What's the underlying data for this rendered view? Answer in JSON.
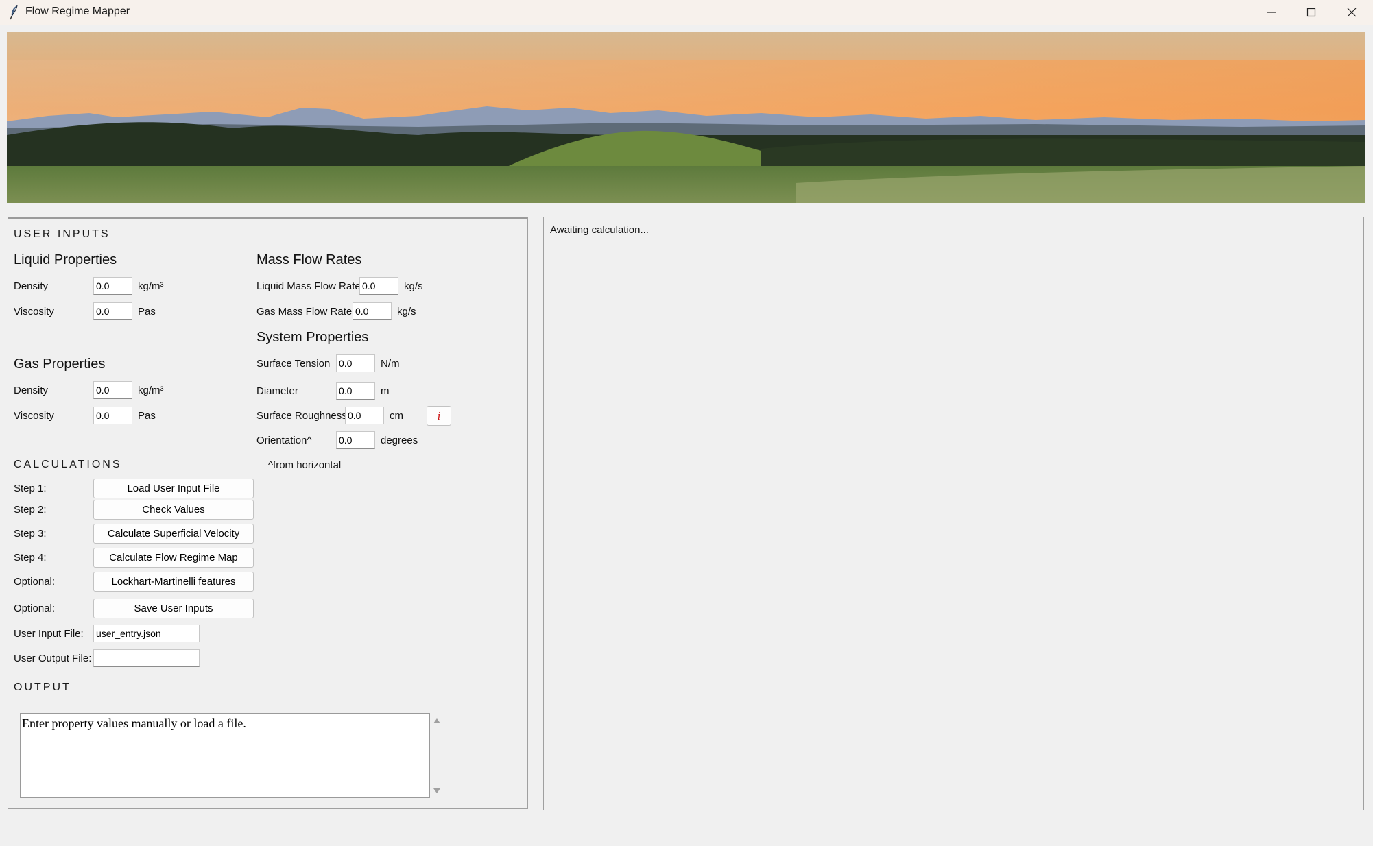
{
  "window": {
    "title": "Flow Regime Mapper"
  },
  "user_inputs": {
    "section_label": "USER INPUTS",
    "liquid": {
      "heading": "Liquid Properties",
      "density": {
        "label": "Density",
        "value": "0.0",
        "unit": "kg/m³"
      },
      "viscosity": {
        "label": "Viscosity",
        "value": "0.0",
        "unit": "Pas"
      }
    },
    "gas": {
      "heading": "Gas Properties",
      "density": {
        "label": "Density",
        "value": "0.0",
        "unit": "kg/m³"
      },
      "viscosity": {
        "label": "Viscosity",
        "value": "0.0",
        "unit": "Pas"
      }
    },
    "mass_flow": {
      "heading": "Mass Flow Rates",
      "liquid": {
        "label": "Liquid Mass Flow Rate",
        "value": "0.0",
        "unit": "kg/s"
      },
      "gas": {
        "label": "Gas Mass Flow Rate",
        "value": "0.0",
        "unit": "kg/s"
      }
    },
    "system": {
      "heading": "System Properties",
      "surface_tension": {
        "label": "Surface Tension",
        "value": "0.0",
        "unit": "N/m"
      },
      "diameter": {
        "label": "Diameter",
        "value": "0.0",
        "unit": "m"
      },
      "roughness": {
        "label": "Surface Roughness",
        "value": "0.0",
        "unit": "cm",
        "info": "i"
      },
      "orientation": {
        "label": "Orientation^",
        "value": "0.0",
        "unit": "degrees",
        "note": "^from horizontal"
      }
    }
  },
  "calculations": {
    "section_label": "CALCULATIONS",
    "steps": [
      {
        "label": "Step 1:",
        "button": "Load User Input File"
      },
      {
        "label": "Step 2:",
        "button": "Check Values"
      },
      {
        "label": "Step 3:",
        "button": "Calculate Superficial Velocity"
      },
      {
        "label": "Step 4:",
        "button": "Calculate Flow Regime Map"
      },
      {
        "label": "Optional:",
        "button": "Lockhart-Martinelli features"
      },
      {
        "label": "Optional:",
        "button": "Save User Inputs"
      }
    ],
    "input_file": {
      "label": "User Input File:",
      "value": "user_entry.json"
    },
    "output_file": {
      "label": "User Output File:",
      "value": ""
    }
  },
  "output": {
    "section_label": "OUTPUT",
    "text": "Enter property values manually or load a file."
  },
  "plot_panel": {
    "status": "Awaiting calculation..."
  },
  "colors": {
    "background": "#f0f0f0",
    "info_icon": "#cc1111",
    "titlebar": "#f7f1ec"
  },
  "icons": [
    "feather-app-icon",
    "minimize-icon",
    "maximize-icon",
    "close-icon",
    "info-icon",
    "scroll-up-icon",
    "scroll-down-icon"
  ]
}
